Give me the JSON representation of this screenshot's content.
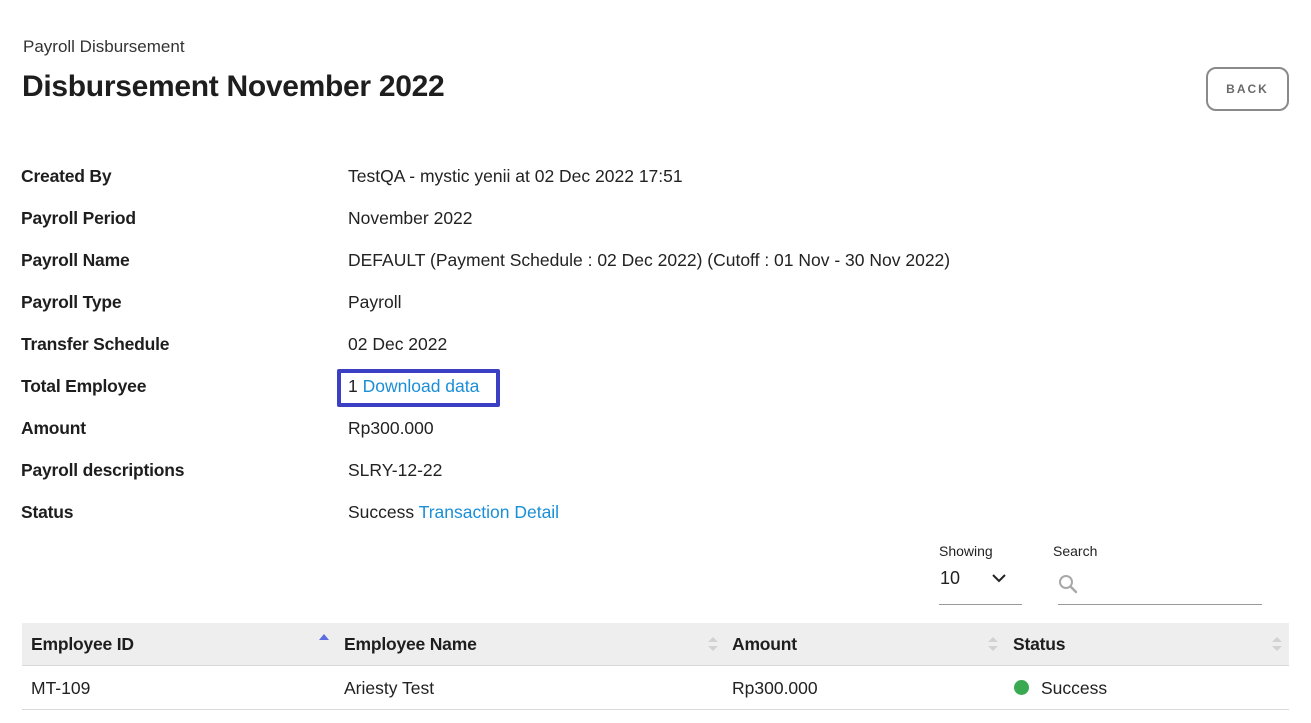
{
  "header": {
    "breadcrumb": "Payroll Disbursement",
    "title": "Disbursement November 2022",
    "back_label": "BACK"
  },
  "details": {
    "created_by": {
      "label": "Created By",
      "value": "TestQA - mystic yenii at 02 Dec 2022 17:51"
    },
    "payroll_period": {
      "label": "Payroll Period",
      "value": "November 2022"
    },
    "payroll_name": {
      "label": "Payroll Name",
      "value": "DEFAULT (Payment Schedule : 02 Dec 2022) (Cutoff : 01 Nov - 30 Nov 2022)"
    },
    "payroll_type": {
      "label": "Payroll Type",
      "value": "Payroll"
    },
    "transfer_schedule": {
      "label": "Transfer Schedule",
      "value": "02 Dec 2022"
    },
    "total_employee": {
      "label": "Total Employee",
      "value": "1",
      "link": "Download data"
    },
    "amount": {
      "label": "Amount",
      "value": "Rp300.000"
    },
    "payroll_descriptions": {
      "label": "Payroll descriptions",
      "value": "SLRY-12-22"
    },
    "status": {
      "label": "Status",
      "value": "Success",
      "link": "Transaction Detail"
    }
  },
  "controls": {
    "showing_label": "Showing",
    "showing_value": "10",
    "search_label": "Search",
    "search_value": ""
  },
  "table": {
    "columns": [
      "Employee ID",
      "Employee Name",
      "Amount",
      "Status"
    ],
    "sorted_column": "Employee ID",
    "sort_direction": "ascending",
    "rows": [
      {
        "employee_id": "MT-109",
        "employee_name": "Ariesty Test",
        "amount": "Rp300.000",
        "status": "Success"
      }
    ]
  },
  "colors": {
    "link": "#1a8fd6",
    "highlight": "#3a3fc4",
    "success": "#3aaa52",
    "sort_active": "#5b6ee1"
  },
  "icons": {
    "search": "search-icon",
    "dropdown": "chevron-down-icon",
    "sort": "sort-icon"
  }
}
